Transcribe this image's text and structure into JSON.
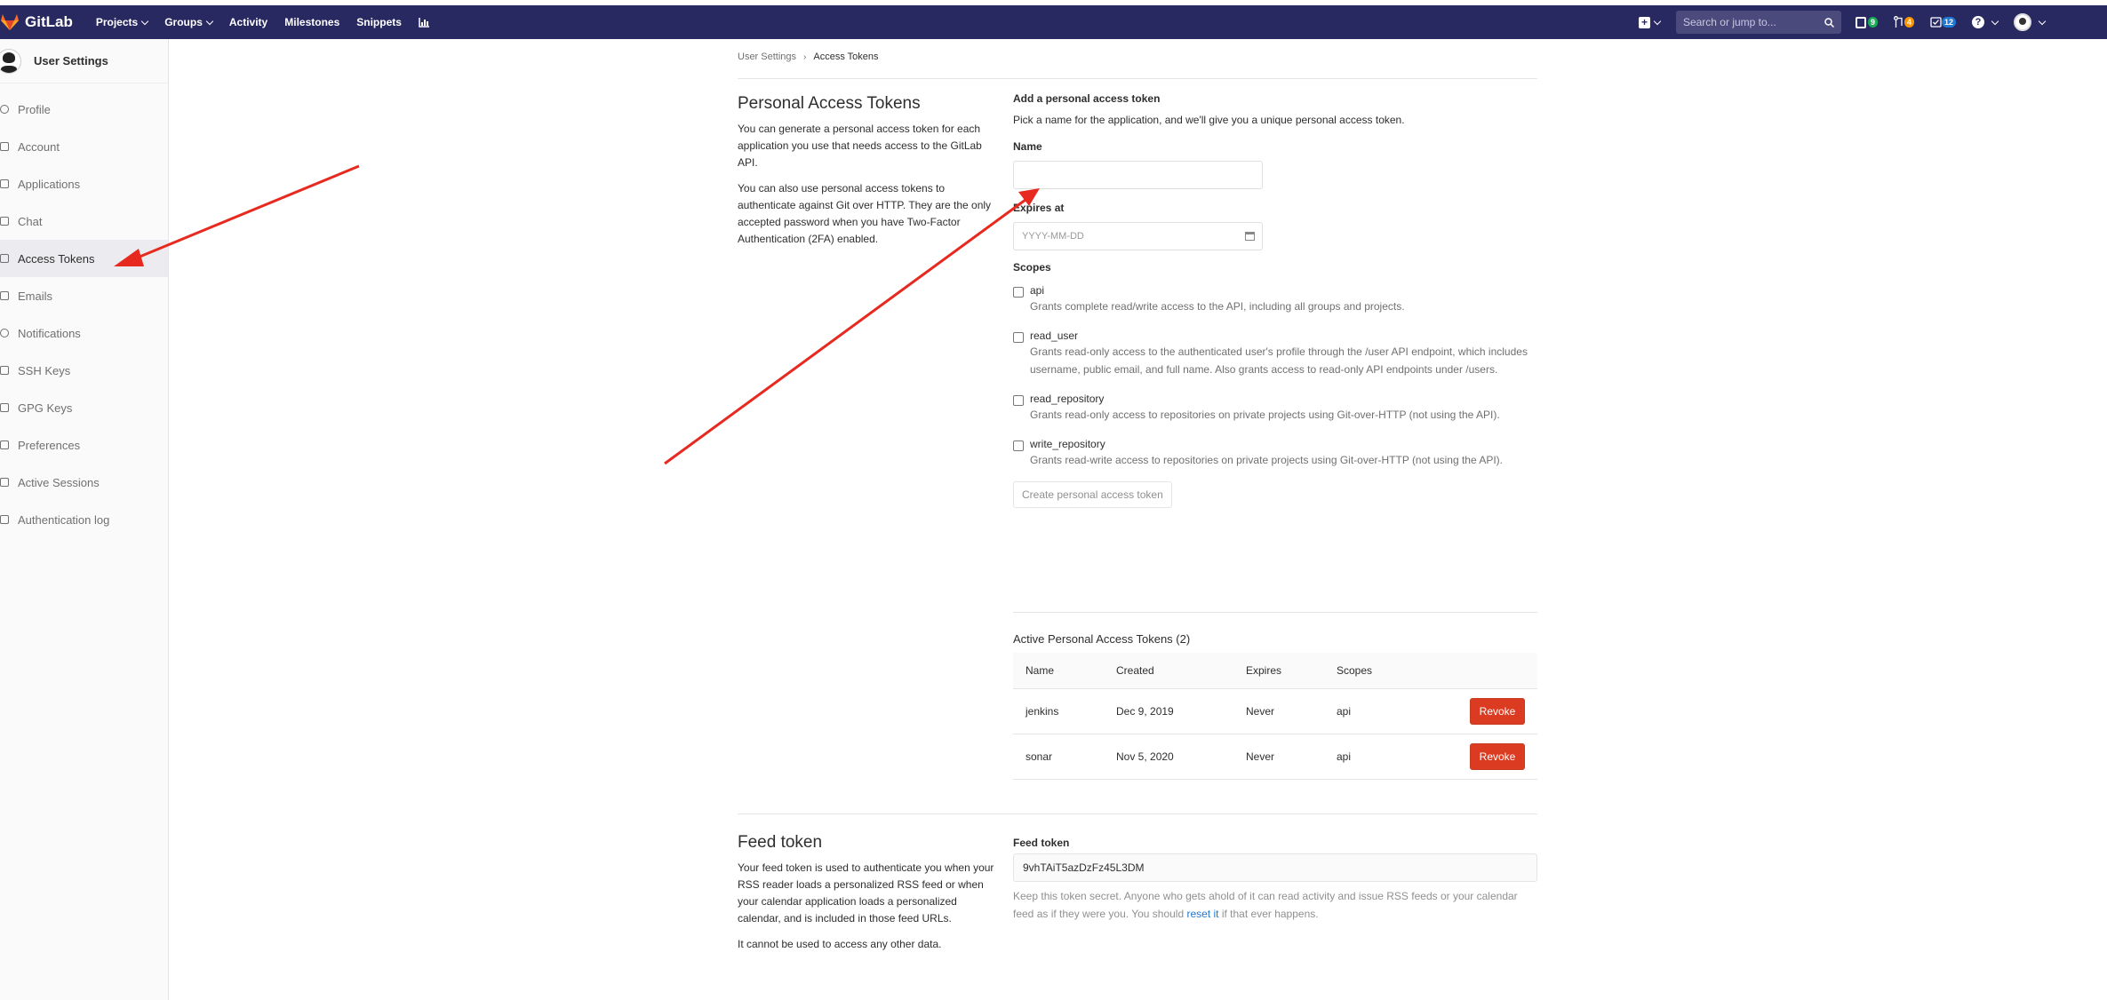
{
  "navbar": {
    "brand": "GitLab",
    "links": [
      "Projects",
      "Groups",
      "Activity",
      "Milestones",
      "Snippets"
    ],
    "search_placeholder": "Search or jump to...",
    "issues_count": "9",
    "mr_count": "4",
    "todo_count": "12",
    "help_icon": "?"
  },
  "sidebar": {
    "title": "User Settings",
    "items": [
      {
        "label": "Profile",
        "icon": "profile-icon"
      },
      {
        "label": "Account",
        "icon": "account-icon"
      },
      {
        "label": "Applications",
        "icon": "applications-icon"
      },
      {
        "label": "Chat",
        "icon": "chat-icon"
      },
      {
        "label": "Access Tokens",
        "icon": "access-tokens-icon"
      },
      {
        "label": "Emails",
        "icon": "emails-icon"
      },
      {
        "label": "Notifications",
        "icon": "notifications-icon"
      },
      {
        "label": "SSH Keys",
        "icon": "ssh-key-icon"
      },
      {
        "label": "GPG Keys",
        "icon": "gpg-key-icon"
      },
      {
        "label": "Preferences",
        "icon": "preferences-icon"
      },
      {
        "label": "Active Sessions",
        "icon": "sessions-icon"
      },
      {
        "label": "Authentication log",
        "icon": "auth-log-icon"
      }
    ],
    "active_index": 4
  },
  "breadcrumb": {
    "parent": "User Settings",
    "current": "Access Tokens"
  },
  "pat": {
    "heading": "Personal Access Tokens",
    "desc1": "You can generate a personal access token for each application you use that needs access to the GitLab API.",
    "desc2": "You can also use personal access tokens to authenticate against Git over HTTP. They are the only accepted password when you have Two-Factor Authentication (2FA) enabled.",
    "form_title": "Add a personal access token",
    "form_hint": "Pick a name for the application, and we'll give you a unique personal access token.",
    "name_label": "Name",
    "name_value": "",
    "expires_label": "Expires at",
    "expires_placeholder": "YYYY-MM-DD",
    "scopes_label": "Scopes",
    "scopes": [
      {
        "name": "api",
        "desc": "Grants complete read/write access to the API, including all groups and projects.",
        "checked": false
      },
      {
        "name": "read_user",
        "desc": "Grants read-only access to the authenticated user's profile through the /user API endpoint, which includes username, public email, and full name. Also grants access to read-only API endpoints under /users.",
        "checked": false
      },
      {
        "name": "read_repository",
        "desc": "Grants read-only access to repositories on private projects using Git-over-HTTP (not using the API).",
        "checked": false
      },
      {
        "name": "write_repository",
        "desc": "Grants read-write access to repositories on private projects using Git-over-HTTP (not using the API).",
        "checked": false
      }
    ],
    "create_button": "Create personal access token"
  },
  "active_tokens": {
    "title": "Active Personal Access Tokens (2)",
    "columns": [
      "Name",
      "Created",
      "Expires",
      "Scopes"
    ],
    "rows": [
      {
        "name": "jenkins",
        "created": "Dec 9, 2019",
        "expires": "Never",
        "scopes": "api",
        "action": "Revoke"
      },
      {
        "name": "sonar",
        "created": "Nov 5, 2020",
        "expires": "Never",
        "scopes": "api",
        "action": "Revoke"
      }
    ]
  },
  "feed": {
    "heading": "Feed token",
    "desc1": "Your feed token is used to authenticate you when your RSS reader loads a personalized RSS feed or when your calendar application loads a personalized calendar, and is included in those feed URLs.",
    "desc2": "It cannot be used to access any other data.",
    "label": "Feed token",
    "value": "9vhTAiT5azDzFz45L3DM",
    "help_before": "Keep this token secret. Anyone who gets ahold of it can read activity and issue RSS feeds or your calendar feed as if they were you. You should",
    "help_link": "reset it",
    "help_after": "if that ever happens."
  },
  "colors": {
    "navbar": "#292961",
    "revoke": "#db3b21",
    "annotation_arrow": "#e8291f"
  }
}
